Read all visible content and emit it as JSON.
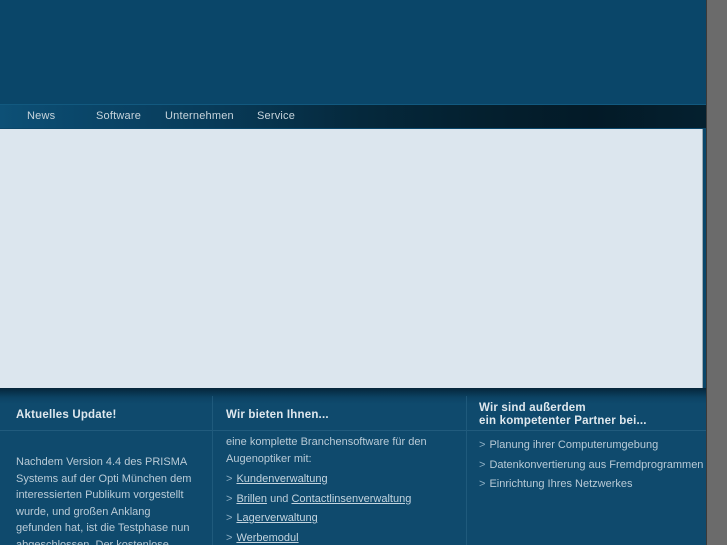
{
  "nav": {
    "items": [
      {
        "label": "News"
      },
      {
        "label": "Software"
      },
      {
        "label": "Unternehmen"
      },
      {
        "label": "Service"
      }
    ]
  },
  "footer": {
    "columns": [
      {
        "heading": "Aktuelles Update!",
        "body": "Nachdem Version 4.4 des PRISMA Systems auf der Opti München dem interessierten Publikum vorgestellt wurde, und großen Anklang gefunden hat, ist die Testphase nun abgeschlossen. Der kostenlose"
      },
      {
        "heading": "Wir bieten Ihnen...",
        "intro": "eine komplette Branchensoftware für den Augenoptiker mit:",
        "items": [
          {
            "marker": ">",
            "parts": [
              {
                "text": "Kundenverwaltung",
                "link": true
              }
            ]
          },
          {
            "marker": ">",
            "parts": [
              {
                "text": "Brillen",
                "link": true
              },
              {
                "text": " und ",
                "link": false
              },
              {
                "text": "Contactlinsenverwaltung",
                "link": true
              }
            ]
          },
          {
            "marker": ">",
            "parts": [
              {
                "text": "Lagerverwaltung",
                "link": true
              }
            ]
          },
          {
            "marker": ">",
            "parts": [
              {
                "text": "Werbemodul",
                "link": true
              }
            ]
          }
        ]
      },
      {
        "heading_line1": "Wir sind außerdem",
        "heading_line2": "ein kompetenter Partner bei...",
        "items": [
          {
            "marker": ">",
            "label": "Planung ihrer Computerumgebung"
          },
          {
            "marker": ">",
            "label": "Datenkonvertierung aus Fremdprogrammen"
          },
          {
            "marker": ">",
            "label": "Einrichtung Ihres Netzwerkes"
          }
        ]
      }
    ]
  },
  "colors": {
    "header_blue": "#0a4669",
    "content_light": "#dce6ee",
    "footer_blue": "#0f4a6d",
    "nav_text": "#c7d4dc",
    "scrollbar_gray": "#6b6b6b"
  }
}
